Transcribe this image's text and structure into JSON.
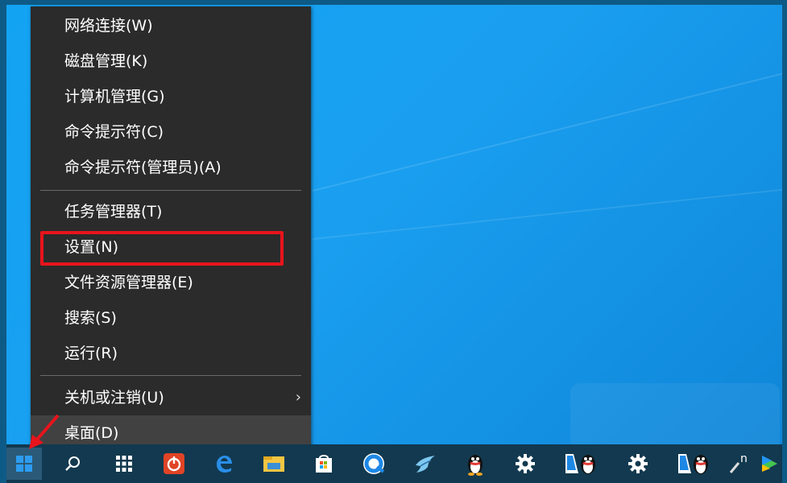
{
  "menu": {
    "items": [
      {
        "label": "网络连接(W)"
      },
      {
        "label": "磁盘管理(K)"
      },
      {
        "label": "计算机管理(G)"
      },
      {
        "label": "命令提示符(C)"
      },
      {
        "label": "命令提示符(管理员)(A)"
      },
      {
        "label": "任务管理器(T)"
      },
      {
        "label": "设置(N)"
      },
      {
        "label": "文件资源管理器(E)"
      },
      {
        "label": "搜索(S)"
      },
      {
        "label": "运行(R)"
      },
      {
        "label": "关机或注销(U)"
      },
      {
        "label": "桌面(D)"
      }
    ],
    "submenu_arrow": "›"
  },
  "taskbar": {
    "icons": [
      {
        "name": "start-icon"
      },
      {
        "name": "search-icon"
      },
      {
        "name": "apps-grid-icon"
      },
      {
        "name": "power-app-icon"
      },
      {
        "name": "edge-icon"
      },
      {
        "name": "file-explorer-icon"
      },
      {
        "name": "store-icon"
      },
      {
        "name": "browser-icon"
      },
      {
        "name": "bird-app-icon"
      },
      {
        "name": "qq-icon"
      },
      {
        "name": "settings-icon"
      },
      {
        "name": "qq-pinned-icon"
      },
      {
        "name": "settings-icon-2"
      },
      {
        "name": "qq-pinned-icon-2"
      },
      {
        "name": "pen-icon"
      },
      {
        "name": "video-player-icon"
      }
    ],
    "pen_glyph": "n"
  },
  "colors": {
    "desktop": "#1a9ff0",
    "menu_bg": "#2b2b2b",
    "menu_hover": "#414141",
    "highlight": "#e8141c",
    "taskbar": "#12394f",
    "accent": "#2d9cf0"
  }
}
